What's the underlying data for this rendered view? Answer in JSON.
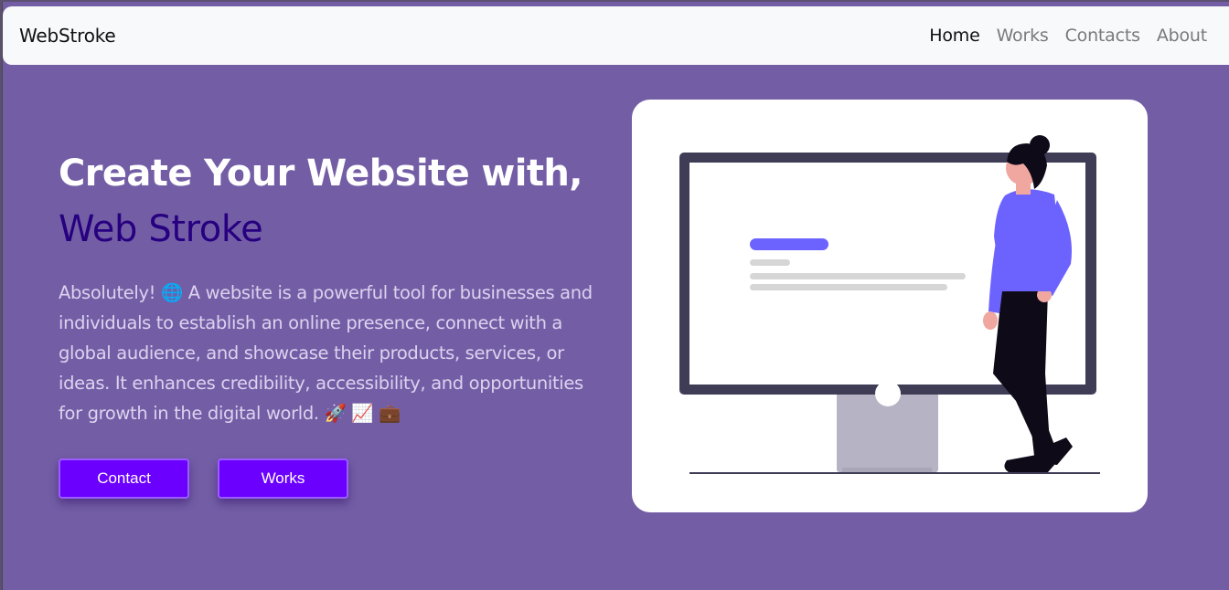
{
  "navbar": {
    "brand": "WebStroke",
    "links": [
      {
        "label": "Home",
        "active": true
      },
      {
        "label": "Works",
        "active": false
      },
      {
        "label": "Contacts",
        "active": false
      },
      {
        "label": "About",
        "active": false
      }
    ]
  },
  "hero": {
    "title_line1": "Create Your Website with,",
    "title_line2": "Web Stroke",
    "description": "Absolutely! 🌐 A website is a powerful tool for businesses and individuals to establish an online presence, connect with a global audience, and showcase their products, services, or ideas. It enhances credibility, accessibility, and opportunities for growth in the digital world. 🚀 📈 💼",
    "buttons": {
      "contact_label": "Contact",
      "works_label": "Works"
    }
  },
  "illustration": {
    "name": "person-presenting-monitor-illustration"
  },
  "colors": {
    "background": "#735ea6",
    "accent": "#6c00ff",
    "title_highlight": "#270080",
    "illustration_accent": "#6c63ff"
  }
}
